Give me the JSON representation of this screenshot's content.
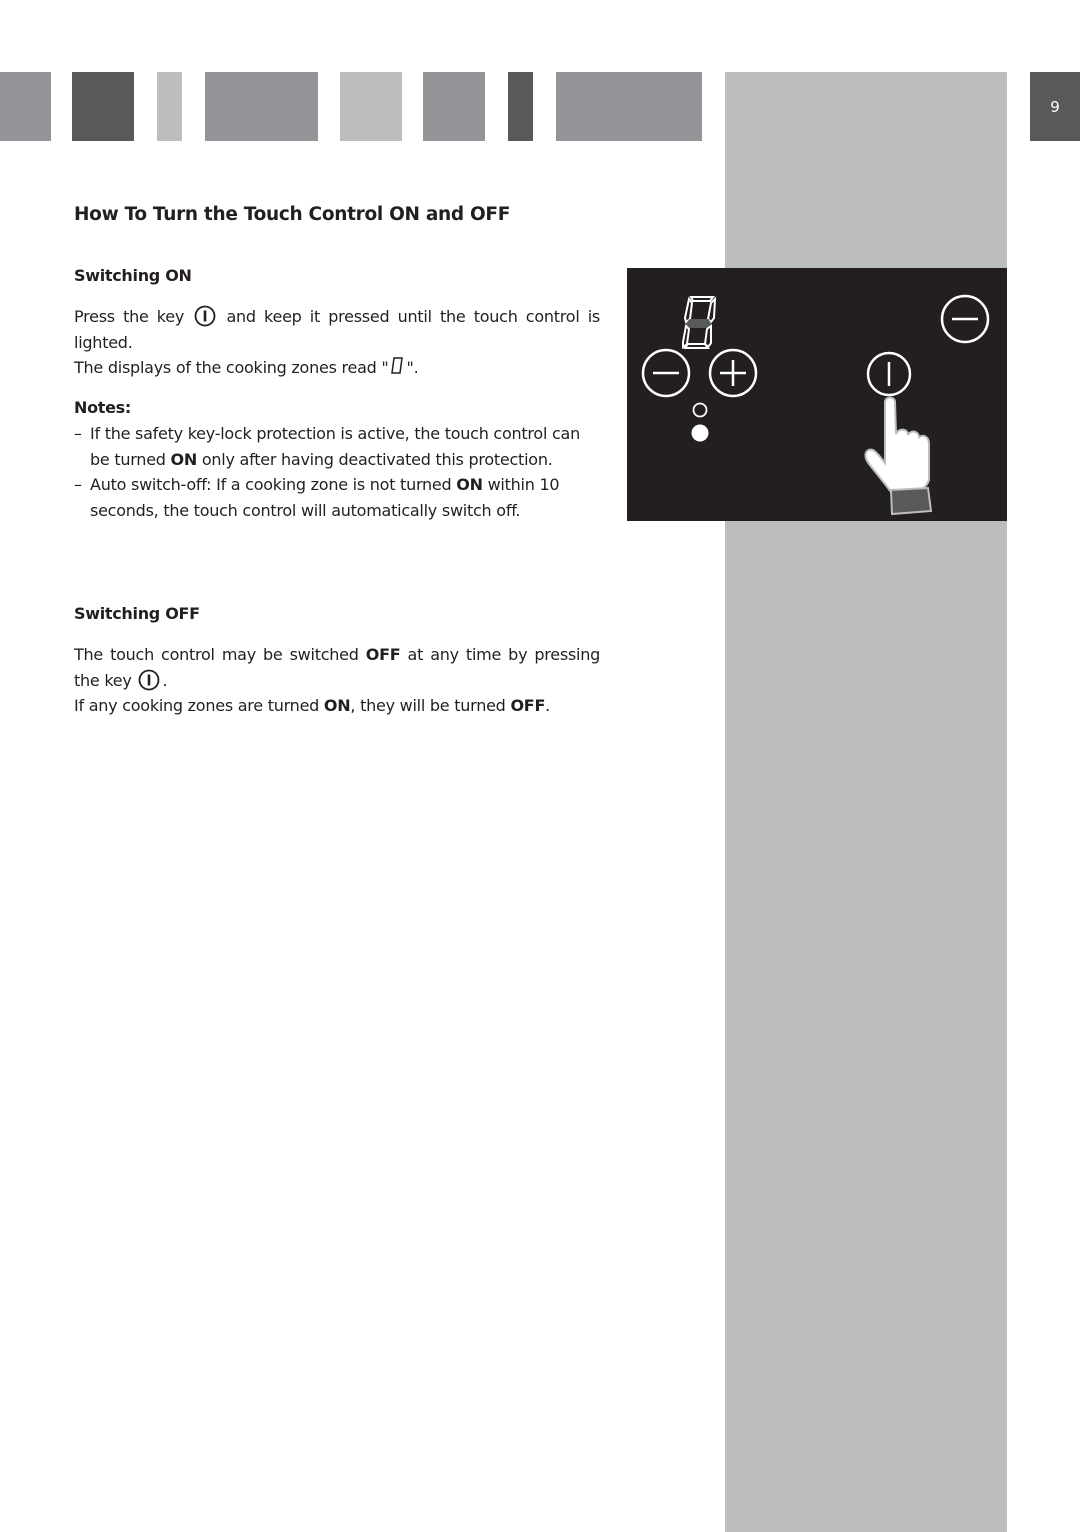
{
  "header": {
    "page_number": "9",
    "colors": {
      "mid_grey": "#939598",
      "dark_grey": "#58595b",
      "light_grey": "#bcbdbf"
    }
  },
  "section": {
    "title": "How To Turn the Touch Control ON and OFF",
    "switching_on": {
      "heading": "Switching ON",
      "line1_before": "Press the key",
      "line1_after": "and keep it pressed until the touch control is lighted.",
      "line2_before": "The displays of the cooking zones read \"",
      "line2_after": "\".",
      "notes_heading": "Notes:",
      "notes": [
        {
          "dash": "–",
          "before": "If the safety key-lock protection is active, the touch control can be turned",
          "bold": "ON",
          "after": "only after having deactivated this protection."
        },
        {
          "dash": "–",
          "before": "Auto switch-off: If a cooking zone is not turned",
          "bold": "ON",
          "after": "within 10 seconds, the touch control will automatically switch off."
        }
      ]
    },
    "switching_off": {
      "heading": "Switching OFF",
      "line1_before": "The touch control may be switched",
      "line1_bold": "OFF",
      "line1_after": "at any time by pressing the key",
      "line1_end": ".",
      "line2_before": "If any cooking zones are turned",
      "line2_bold1": "ON",
      "line2_mid": ", they will be turned",
      "line2_bold2": "OFF",
      "line2_end": "."
    }
  },
  "illustration": {
    "display_digit": "0",
    "icons": [
      "seven-segment-display",
      "minus-key",
      "plus-key",
      "indicator-ring",
      "indicator-dot",
      "minus-key-timer",
      "power-key",
      "pressing-hand"
    ]
  }
}
